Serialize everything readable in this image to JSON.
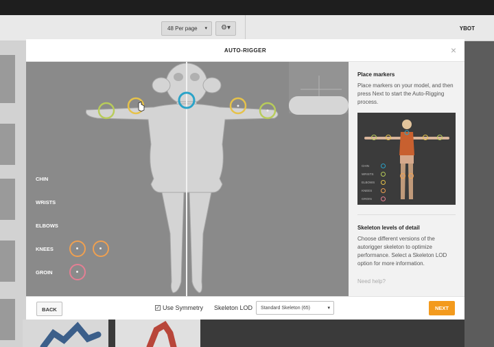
{
  "app": {
    "per_page_label": "48 Per page",
    "user_name": "YBOT"
  },
  "modal": {
    "title": "AUTO-RIGGER",
    "close_glyph": "×"
  },
  "viewport": {
    "marker_labels": [
      "CHIN",
      "WRISTS",
      "ELBOWS",
      "KNEES",
      "GROIN"
    ],
    "colors": {
      "chin": "#2aa3c8",
      "wrists": "#b8cc5a",
      "elbows": "#e6c24a",
      "knees": "#f0a050",
      "groin": "#e57f93"
    }
  },
  "side_panel": {
    "place_title": "Place markers",
    "place_text": "Place markers on your model, and then press Next to start the Auto-Rigging process.",
    "legend": [
      "CHIN",
      "WRISTS",
      "ELBOWS",
      "KNEES",
      "GROIN"
    ],
    "lod_title": "Skeleton levels of detail",
    "lod_text": "Choose different versions of the autorigger skeleton to optimize performance. Select a Skeleton LOD option for more information.",
    "help_link": "Need help?"
  },
  "footer": {
    "back_label": "BACK",
    "symmetry_checked": true,
    "symmetry_label": "Use Symmetry",
    "lod_label": "Skeleton LOD",
    "lod_value": "Standard Skeleton (65)",
    "next_label": "NEXT",
    "next_color": "#f39a1d"
  },
  "icons": {
    "settings": "gear-icon",
    "close": "close-icon",
    "cursor": "hand-cursor-icon",
    "dropdown": "chevron-down-icon"
  }
}
